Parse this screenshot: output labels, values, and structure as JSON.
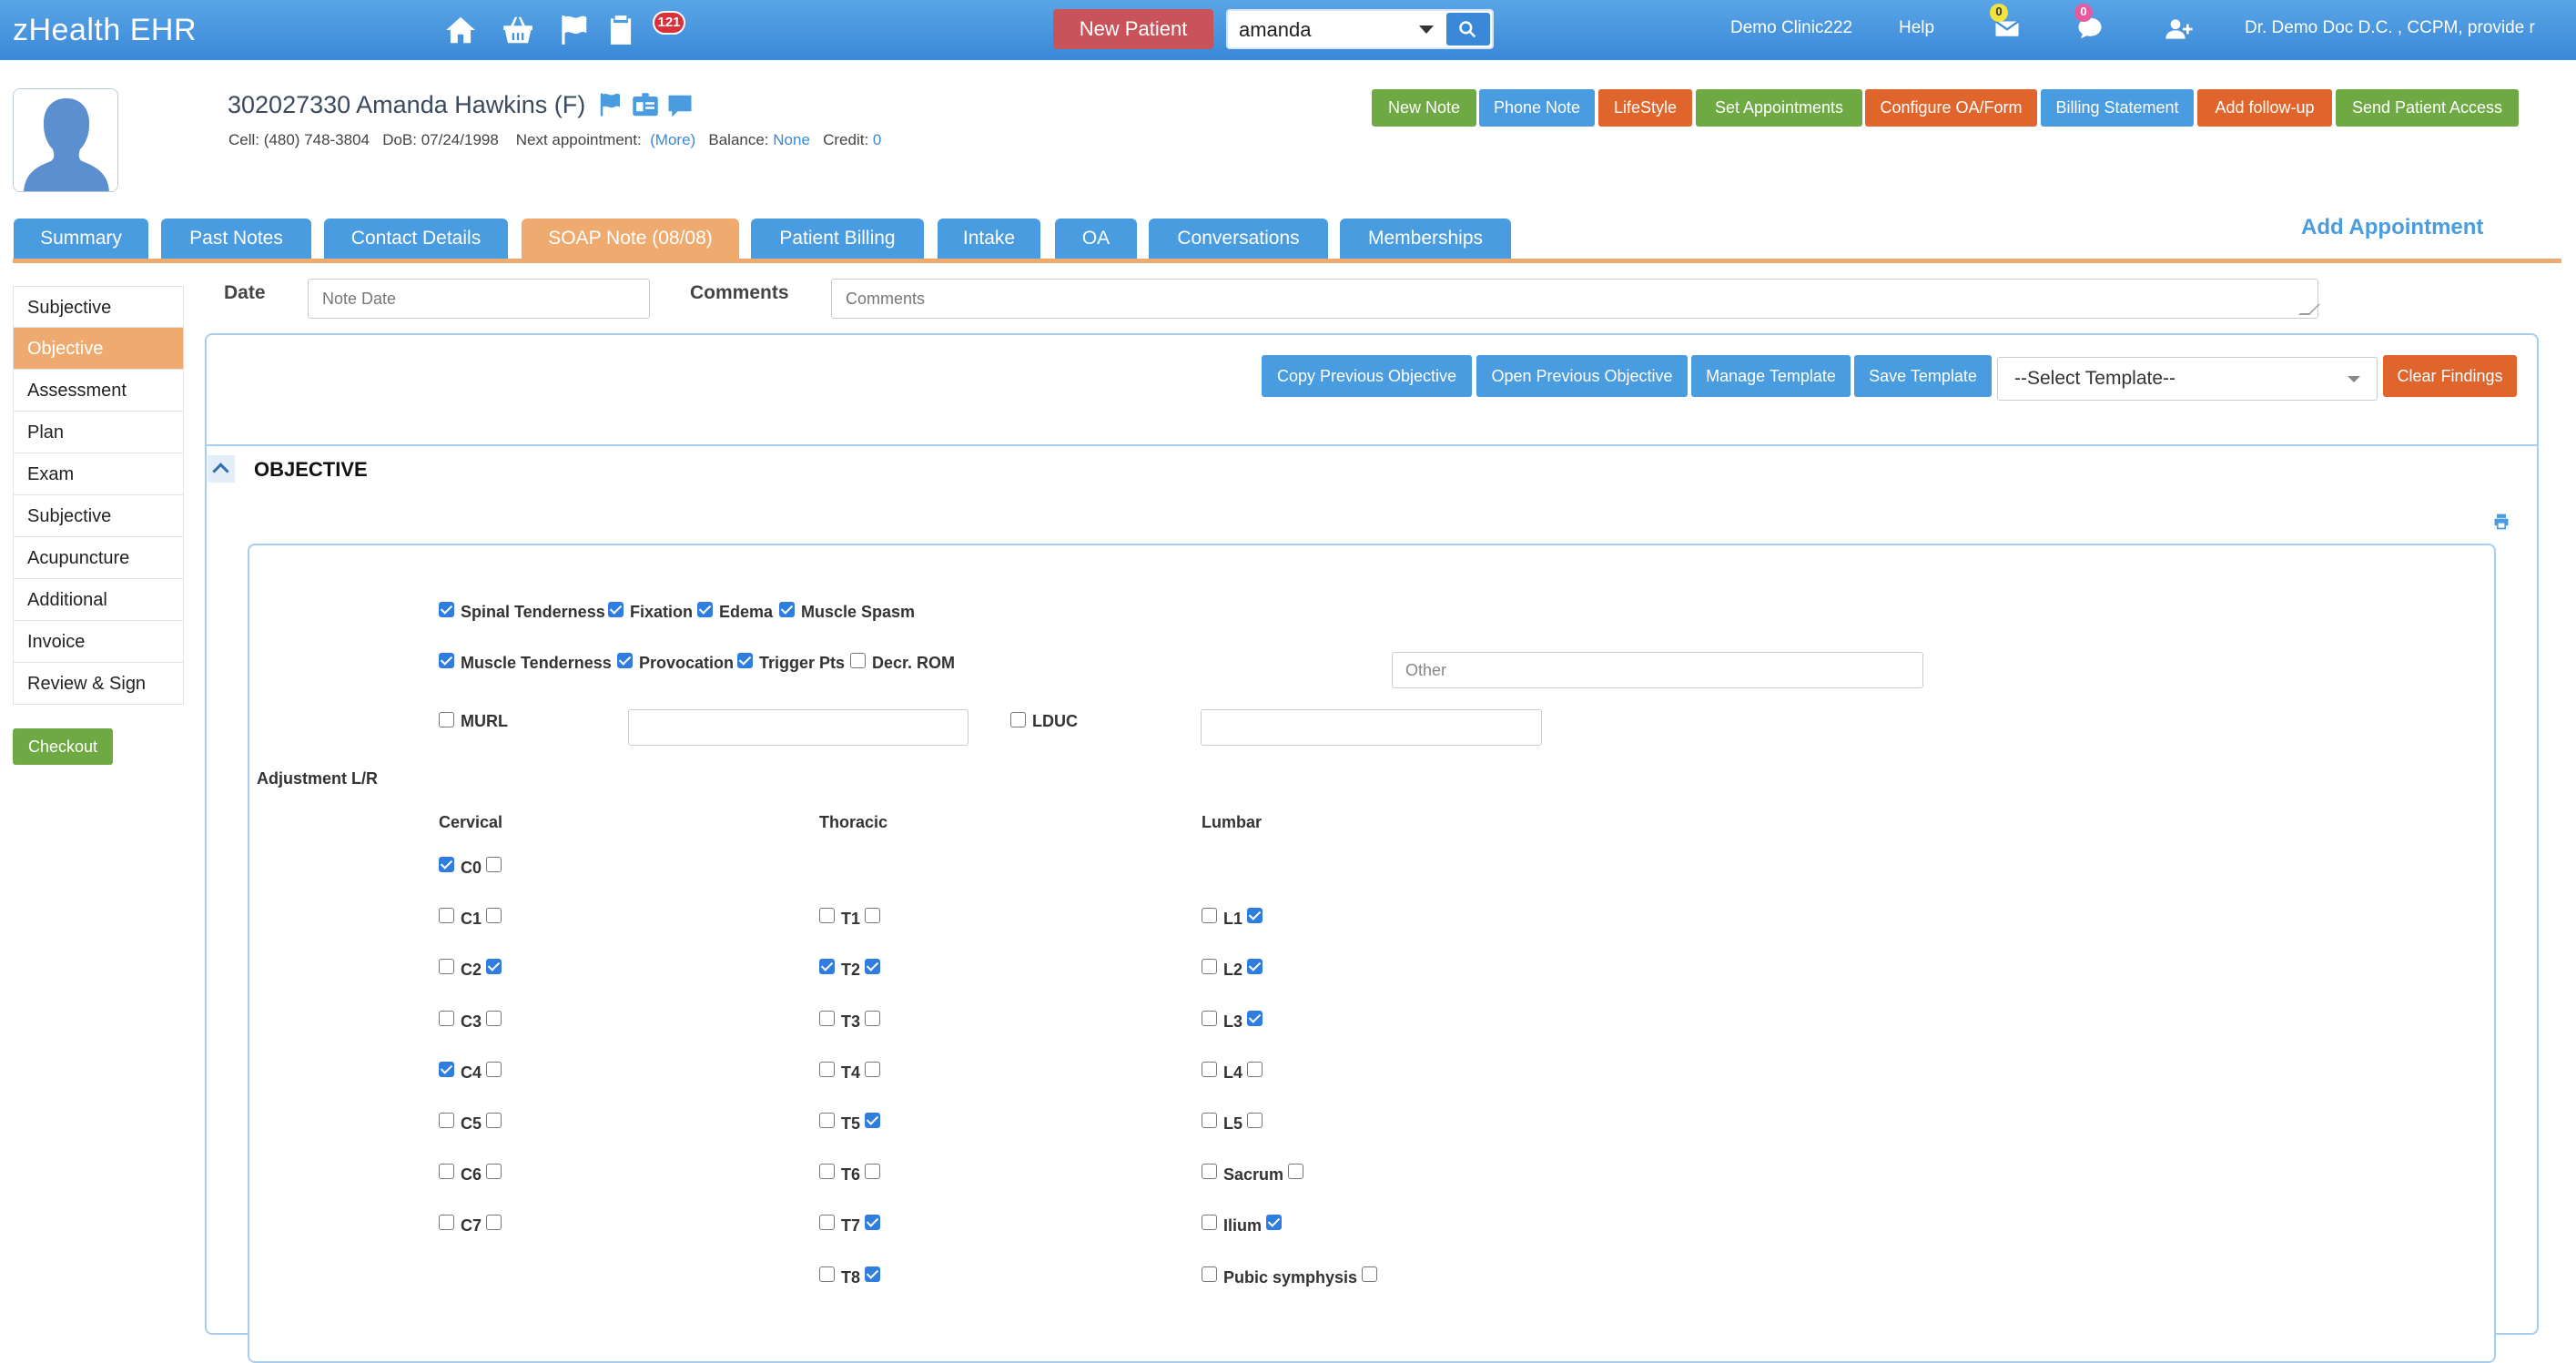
{
  "app": {
    "brand": "zHealth EHR",
    "tasks_badge": "121",
    "messages_badge": "0",
    "chat_badge": "0",
    "new_patient": "New Patient",
    "search_value": "amanda",
    "clinic": "Demo Clinic222",
    "help": "Help",
    "user": "Dr. Demo Doc D.C. , CCPM, provide r"
  },
  "patient": {
    "title": "302027330 Amanda Hawkins (F)",
    "cell_label": "Cell:",
    "cell": "(480) 748-3804",
    "dob_label": "DoB:",
    "dob": "07/24/1998",
    "next_appt_label": "Next appointment:",
    "next_appt_link": "(More)",
    "balance_label": "Balance:",
    "balance": "None",
    "credit_label": "Credit:",
    "credit": "0"
  },
  "actions": {
    "new_note": "New Note",
    "phone_note": "Phone Note",
    "lifestyle": "LifeStyle",
    "set_appointments": "Set Appointments",
    "configure": "Configure OA/Form",
    "billing_statement": "Billing Statement",
    "add_followup": "Add follow-up",
    "send_access": "Send Patient Access"
  },
  "tabs": {
    "summary": "Summary",
    "past_notes": "Past Notes",
    "contact": "Contact Details",
    "soap": "SOAP Note (08/08)",
    "billing": "Patient Billing",
    "intake": "Intake",
    "oa": "OA",
    "conversations": "Conversations",
    "memberships": "Memberships",
    "add_appointment": "Add Appointment"
  },
  "sidenav": {
    "items": [
      "Subjective",
      "Objective",
      "Assessment",
      "Plan",
      "Exam",
      "Subjective",
      "Acupuncture",
      "Additional",
      "Invoice",
      "Review & Sign"
    ],
    "active_index": 1,
    "checkout": "Checkout"
  },
  "note": {
    "date_label": "Date",
    "date_placeholder": "Note Date",
    "comments_label": "Comments",
    "comments_placeholder": "Comments"
  },
  "toolbar": {
    "copy_prev": "Copy Previous Objective",
    "open_prev": "Open Previous Objective",
    "manage_template": "Manage Template",
    "save_template": "Save Template",
    "select_template": "--Select Template--",
    "clear_findings": "Clear Findings"
  },
  "objective": {
    "title": "OBJECTIVE",
    "findings": {
      "spinal_tenderness": {
        "label": "Spinal Tenderness",
        "checked": true
      },
      "fixation": {
        "label": "Fixation",
        "checked": true
      },
      "edema": {
        "label": "Edema",
        "checked": true
      },
      "muscle_spasm": {
        "label": "Muscle Spasm",
        "checked": true
      },
      "muscle_tenderness": {
        "label": "Muscle Tenderness",
        "checked": true
      },
      "provocation": {
        "label": "Provocation",
        "checked": true
      },
      "trigger_pts": {
        "label": "Trigger Pts",
        "checked": true
      },
      "decr_rom": {
        "label": "Decr. ROM",
        "checked": false
      },
      "other_placeholder": "Other",
      "murl": {
        "label": "MURL",
        "checked": false
      },
      "lduc": {
        "label": "LDUC",
        "checked": false
      }
    },
    "adjustment_label": "Adjustment L/R",
    "cervical_label": "Cervical",
    "thoracic_label": "Thoracic",
    "lumbar_label": "Lumbar",
    "cervical": [
      {
        "label": "C0",
        "l": true,
        "r": false
      },
      {
        "label": "C1",
        "l": false,
        "r": false
      },
      {
        "label": "C2",
        "l": false,
        "r": true
      },
      {
        "label": "C3",
        "l": false,
        "r": false
      },
      {
        "label": "C4",
        "l": true,
        "r": false
      },
      {
        "label": "C5",
        "l": false,
        "r": false
      },
      {
        "label": "C6",
        "l": false,
        "r": false
      },
      {
        "label": "C7",
        "l": false,
        "r": false
      }
    ],
    "thoracic": [
      {
        "label": "T1",
        "l": false,
        "r": false
      },
      {
        "label": "T2",
        "l": true,
        "r": true
      },
      {
        "label": "T3",
        "l": false,
        "r": false
      },
      {
        "label": "T4",
        "l": false,
        "r": false
      },
      {
        "label": "T5",
        "l": false,
        "r": true
      },
      {
        "label": "T6",
        "l": false,
        "r": false
      },
      {
        "label": "T7",
        "l": false,
        "r": true
      },
      {
        "label": "T8",
        "l": false,
        "r": true
      }
    ],
    "lumbar": [
      {
        "label": "L1",
        "l": false,
        "r": true
      },
      {
        "label": "L2",
        "l": false,
        "r": true
      },
      {
        "label": "L3",
        "l": false,
        "r": true
      },
      {
        "label": "L4",
        "l": false,
        "r": false
      },
      {
        "label": "L5",
        "l": false,
        "r": false
      },
      {
        "label": "Sacrum",
        "l": false,
        "r": false
      },
      {
        "label": "Ilium",
        "l": false,
        "r": true
      },
      {
        "label": "Pubic symphysis",
        "l": false,
        "r": false
      }
    ]
  }
}
